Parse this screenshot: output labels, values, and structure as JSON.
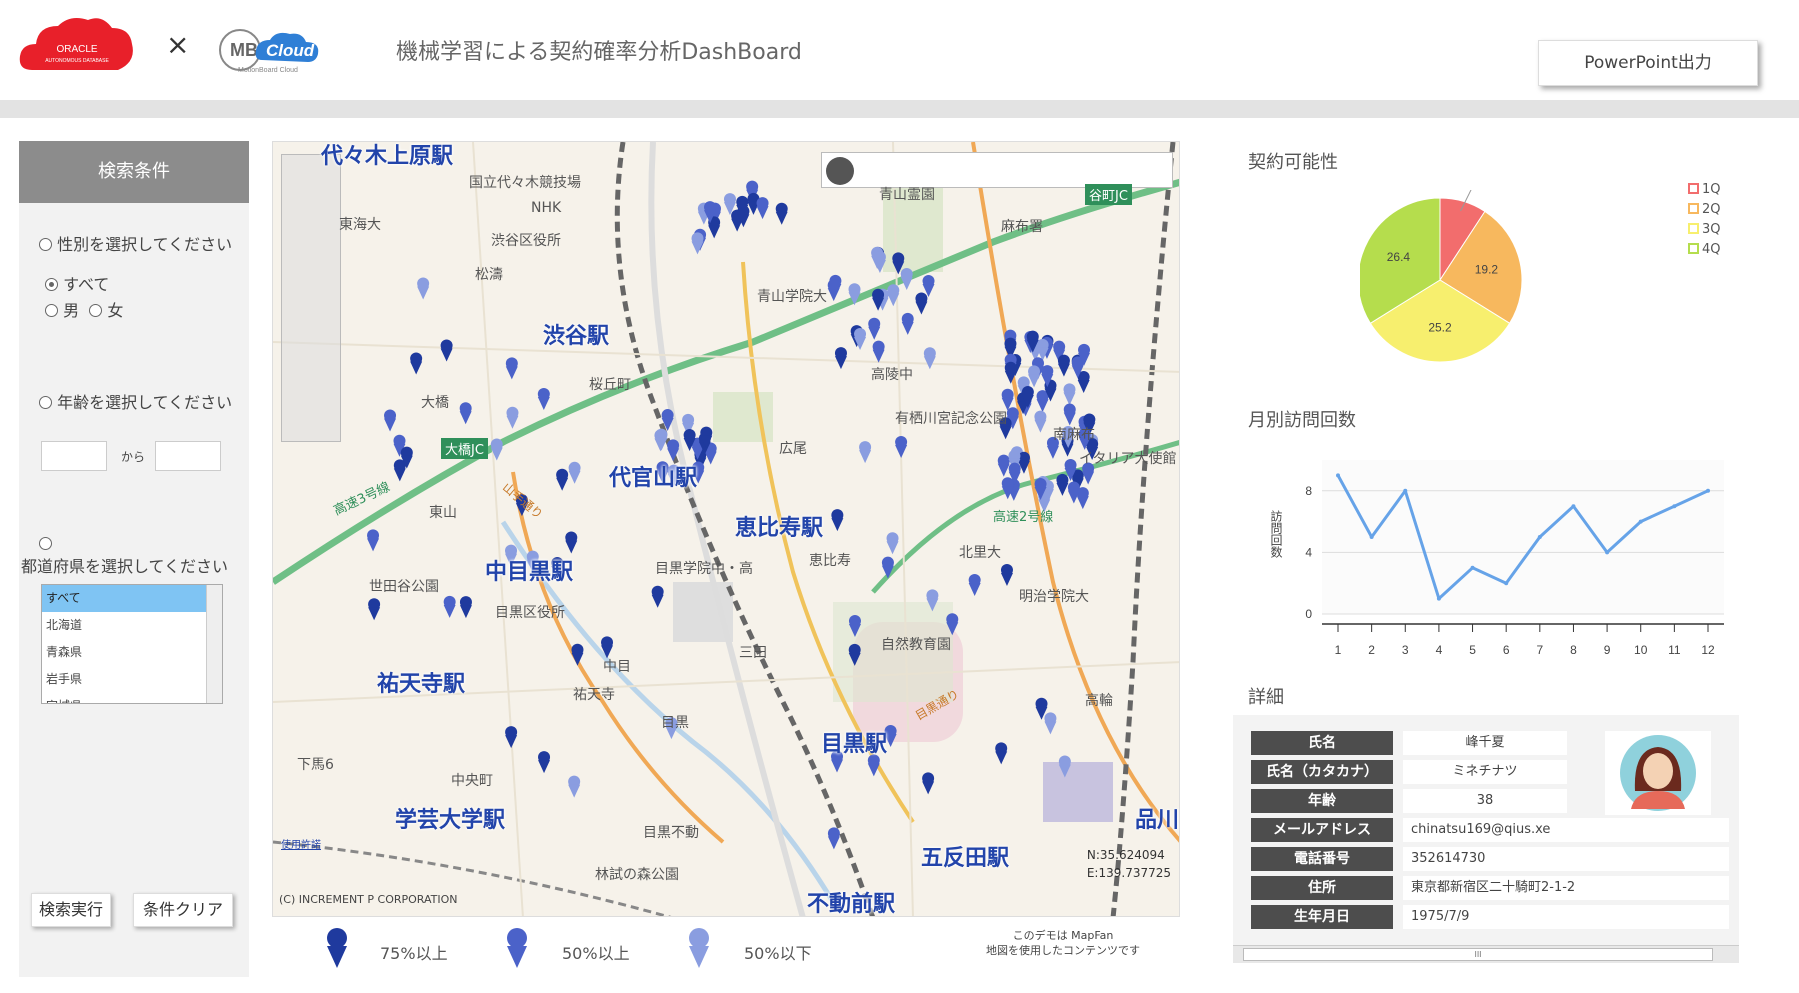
{
  "header": {
    "oracle_logo_text": "ORACLE",
    "oracle_logo_sub": "AUTONOMOUS DATABASE",
    "times": "×",
    "mb_logo_mb": "MB",
    "mb_logo_cloud": "Cloud",
    "mb_logo_sub": "MotionBoard Cloud",
    "title": "機械学習による契約確率分析DashBoard",
    "ppt_button": "PowerPoint出力"
  },
  "sidebar": {
    "title": "検索条件",
    "gender_label": "性別を選択してください",
    "gender_options": [
      "すべて",
      "男",
      "女"
    ],
    "gender_selected": "すべて",
    "age_label": "年齢を選択してください",
    "age_from": "",
    "age_to": "",
    "age_between": "から",
    "pref_label": "都道府県を選択してください",
    "pref_items": [
      "すべて",
      "北海道",
      "青森県",
      "岩手県",
      "宮城県"
    ],
    "search_button": "検索実行",
    "clear_button": "条件クリア"
  },
  "map": {
    "search_value": "",
    "stations": [
      "代々木上原駅",
      "渋谷駅",
      "代官山駅",
      "恵比寿駅",
      "中目黒駅",
      "祐天寺駅",
      "学芸大学駅",
      "目黒駅",
      "五反田駅",
      "不動前駅",
      "品川駅"
    ],
    "places": [
      "国立代々木競技場",
      "NHK",
      "渋谷区役所",
      "松濤",
      "東海大",
      "青山霊園",
      "麻布署",
      "青山学院大",
      "高陵中",
      "有栖川宮記念公園",
      "広尾",
      "桜丘町",
      "大橋",
      "東山",
      "世田谷公園",
      "目黒区役所",
      "目黒学院中・高",
      "恵比寿",
      "北里大",
      "三田",
      "自然教育園",
      "目黒",
      "祐天寺",
      "中目",
      "中央町",
      "目黒不動",
      "林試の森公園",
      "下馬6",
      "高輪",
      "明治学院大",
      "南麻布",
      "イタリア大使館"
    ],
    "junctions": [
      "大橋JC",
      "谷町JC"
    ],
    "roads": [
      "高速3号線",
      "高速2号線",
      "山手通り",
      "目黒通り"
    ],
    "coord_n": "N:35.624094",
    "coord_e": "E:139.737725",
    "copyright": "(C) INCREMENT P CORPORATION",
    "terms": "使用許諾",
    "legend": [
      "75%以上",
      "50%以上",
      "50%以下"
    ],
    "legend_colors": [
      "#1f3a9e",
      "#4b62c9",
      "#8a9de0"
    ],
    "mapfan_note_1": "このデモは MapFan",
    "mapfan_note_2": "地図を使用したコンテンツです"
  },
  "pie_title": "契約可能性",
  "line_title": "月別訪問回数",
  "detail_title": "詳細",
  "chart_data": [
    {
      "type": "pie",
      "title": "契約可能性",
      "categories": [
        "1Q",
        "2Q",
        "3Q",
        "4Q"
      ],
      "values": [
        7.2,
        19.2,
        25.2,
        26.4
      ],
      "colors": [
        "#f26d6d",
        "#f7b85e",
        "#f7ef6e",
        "#b5dd4d"
      ],
      "legend": "right"
    },
    {
      "type": "line",
      "title": "月別訪問回数",
      "xlabel": "",
      "ylabel": "訪問回数",
      "x": [
        1,
        2,
        3,
        4,
        5,
        6,
        7,
        8,
        9,
        10,
        11,
        12
      ],
      "values": [
        9,
        5,
        8,
        1,
        3,
        2,
        5,
        7,
        4,
        6,
        7,
        8
      ],
      "yticks": [
        0,
        4,
        8
      ],
      "color": "#66a3e8"
    }
  ],
  "details": {
    "rows": [
      {
        "label": "氏名",
        "value": "峰千夏"
      },
      {
        "label": "氏名（カタカナ）",
        "value": "ミネチナツ"
      },
      {
        "label": "年齢",
        "value": "38"
      },
      {
        "label": "メールアドレス",
        "value": "chinatsu169@qius.xe"
      },
      {
        "label": "電話番号",
        "value": "352614730"
      },
      {
        "label": "住所",
        "value": "東京都新宿区二十騎町2-1-2"
      },
      {
        "label": "生年月日",
        "value": "1975/7/9"
      }
    ],
    "scroll_grip": "III"
  }
}
